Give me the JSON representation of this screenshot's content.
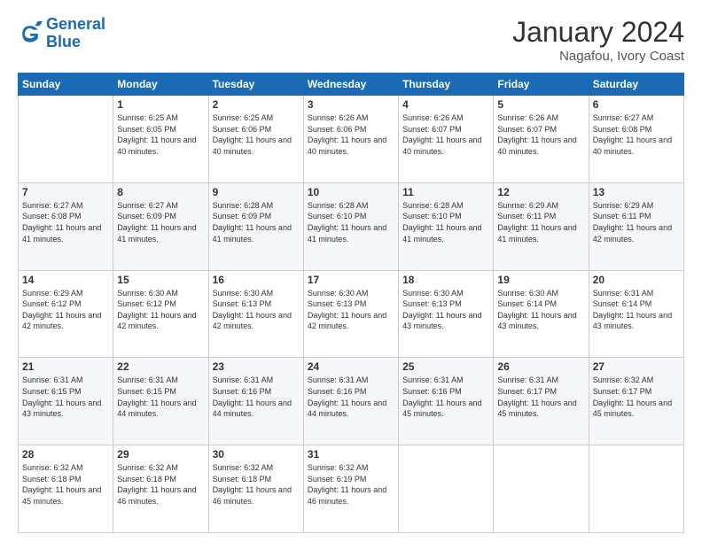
{
  "header": {
    "logo_general": "General",
    "logo_blue": "Blue",
    "main_title": "January 2024",
    "subtitle": "Nagafou, Ivory Coast"
  },
  "calendar": {
    "days_of_week": [
      "Sunday",
      "Monday",
      "Tuesday",
      "Wednesday",
      "Thursday",
      "Friday",
      "Saturday"
    ],
    "weeks": [
      [
        {
          "day": "",
          "sunrise": "",
          "sunset": "",
          "daylight": ""
        },
        {
          "day": "1",
          "sunrise": "Sunrise: 6:25 AM",
          "sunset": "Sunset: 6:05 PM",
          "daylight": "Daylight: 11 hours and 40 minutes."
        },
        {
          "day": "2",
          "sunrise": "Sunrise: 6:25 AM",
          "sunset": "Sunset: 6:06 PM",
          "daylight": "Daylight: 11 hours and 40 minutes."
        },
        {
          "day": "3",
          "sunrise": "Sunrise: 6:26 AM",
          "sunset": "Sunset: 6:06 PM",
          "daylight": "Daylight: 11 hours and 40 minutes."
        },
        {
          "day": "4",
          "sunrise": "Sunrise: 6:26 AM",
          "sunset": "Sunset: 6:07 PM",
          "daylight": "Daylight: 11 hours and 40 minutes."
        },
        {
          "day": "5",
          "sunrise": "Sunrise: 6:26 AM",
          "sunset": "Sunset: 6:07 PM",
          "daylight": "Daylight: 11 hours and 40 minutes."
        },
        {
          "day": "6",
          "sunrise": "Sunrise: 6:27 AM",
          "sunset": "Sunset: 6:08 PM",
          "daylight": "Daylight: 11 hours and 40 minutes."
        }
      ],
      [
        {
          "day": "7",
          "sunrise": "Sunrise: 6:27 AM",
          "sunset": "Sunset: 6:08 PM",
          "daylight": "Daylight: 11 hours and 41 minutes."
        },
        {
          "day": "8",
          "sunrise": "Sunrise: 6:27 AM",
          "sunset": "Sunset: 6:09 PM",
          "daylight": "Daylight: 11 hours and 41 minutes."
        },
        {
          "day": "9",
          "sunrise": "Sunrise: 6:28 AM",
          "sunset": "Sunset: 6:09 PM",
          "daylight": "Daylight: 11 hours and 41 minutes."
        },
        {
          "day": "10",
          "sunrise": "Sunrise: 6:28 AM",
          "sunset": "Sunset: 6:10 PM",
          "daylight": "Daylight: 11 hours and 41 minutes."
        },
        {
          "day": "11",
          "sunrise": "Sunrise: 6:28 AM",
          "sunset": "Sunset: 6:10 PM",
          "daylight": "Daylight: 11 hours and 41 minutes."
        },
        {
          "day": "12",
          "sunrise": "Sunrise: 6:29 AM",
          "sunset": "Sunset: 6:11 PM",
          "daylight": "Daylight: 11 hours and 41 minutes."
        },
        {
          "day": "13",
          "sunrise": "Sunrise: 6:29 AM",
          "sunset": "Sunset: 6:11 PM",
          "daylight": "Daylight: 11 hours and 42 minutes."
        }
      ],
      [
        {
          "day": "14",
          "sunrise": "Sunrise: 6:29 AM",
          "sunset": "Sunset: 6:12 PM",
          "daylight": "Daylight: 11 hours and 42 minutes."
        },
        {
          "day": "15",
          "sunrise": "Sunrise: 6:30 AM",
          "sunset": "Sunset: 6:12 PM",
          "daylight": "Daylight: 11 hours and 42 minutes."
        },
        {
          "day": "16",
          "sunrise": "Sunrise: 6:30 AM",
          "sunset": "Sunset: 6:13 PM",
          "daylight": "Daylight: 11 hours and 42 minutes."
        },
        {
          "day": "17",
          "sunrise": "Sunrise: 6:30 AM",
          "sunset": "Sunset: 6:13 PM",
          "daylight": "Daylight: 11 hours and 42 minutes."
        },
        {
          "day": "18",
          "sunrise": "Sunrise: 6:30 AM",
          "sunset": "Sunset: 6:13 PM",
          "daylight": "Daylight: 11 hours and 43 minutes."
        },
        {
          "day": "19",
          "sunrise": "Sunrise: 6:30 AM",
          "sunset": "Sunset: 6:14 PM",
          "daylight": "Daylight: 11 hours and 43 minutes."
        },
        {
          "day": "20",
          "sunrise": "Sunrise: 6:31 AM",
          "sunset": "Sunset: 6:14 PM",
          "daylight": "Daylight: 11 hours and 43 minutes."
        }
      ],
      [
        {
          "day": "21",
          "sunrise": "Sunrise: 6:31 AM",
          "sunset": "Sunset: 6:15 PM",
          "daylight": "Daylight: 11 hours and 43 minutes."
        },
        {
          "day": "22",
          "sunrise": "Sunrise: 6:31 AM",
          "sunset": "Sunset: 6:15 PM",
          "daylight": "Daylight: 11 hours and 44 minutes."
        },
        {
          "day": "23",
          "sunrise": "Sunrise: 6:31 AM",
          "sunset": "Sunset: 6:16 PM",
          "daylight": "Daylight: 11 hours and 44 minutes."
        },
        {
          "day": "24",
          "sunrise": "Sunrise: 6:31 AM",
          "sunset": "Sunset: 6:16 PM",
          "daylight": "Daylight: 11 hours and 44 minutes."
        },
        {
          "day": "25",
          "sunrise": "Sunrise: 6:31 AM",
          "sunset": "Sunset: 6:16 PM",
          "daylight": "Daylight: 11 hours and 45 minutes."
        },
        {
          "day": "26",
          "sunrise": "Sunrise: 6:31 AM",
          "sunset": "Sunset: 6:17 PM",
          "daylight": "Daylight: 11 hours and 45 minutes."
        },
        {
          "day": "27",
          "sunrise": "Sunrise: 6:32 AM",
          "sunset": "Sunset: 6:17 PM",
          "daylight": "Daylight: 11 hours and 45 minutes."
        }
      ],
      [
        {
          "day": "28",
          "sunrise": "Sunrise: 6:32 AM",
          "sunset": "Sunset: 6:18 PM",
          "daylight": "Daylight: 11 hours and 45 minutes."
        },
        {
          "day": "29",
          "sunrise": "Sunrise: 6:32 AM",
          "sunset": "Sunset: 6:18 PM",
          "daylight": "Daylight: 11 hours and 46 minutes."
        },
        {
          "day": "30",
          "sunrise": "Sunrise: 6:32 AM",
          "sunset": "Sunset: 6:18 PM",
          "daylight": "Daylight: 11 hours and 46 minutes."
        },
        {
          "day": "31",
          "sunrise": "Sunrise: 6:32 AM",
          "sunset": "Sunset: 6:19 PM",
          "daylight": "Daylight: 11 hours and 46 minutes."
        },
        {
          "day": "",
          "sunrise": "",
          "sunset": "",
          "daylight": ""
        },
        {
          "day": "",
          "sunrise": "",
          "sunset": "",
          "daylight": ""
        },
        {
          "day": "",
          "sunrise": "",
          "sunset": "",
          "daylight": ""
        }
      ]
    ]
  }
}
